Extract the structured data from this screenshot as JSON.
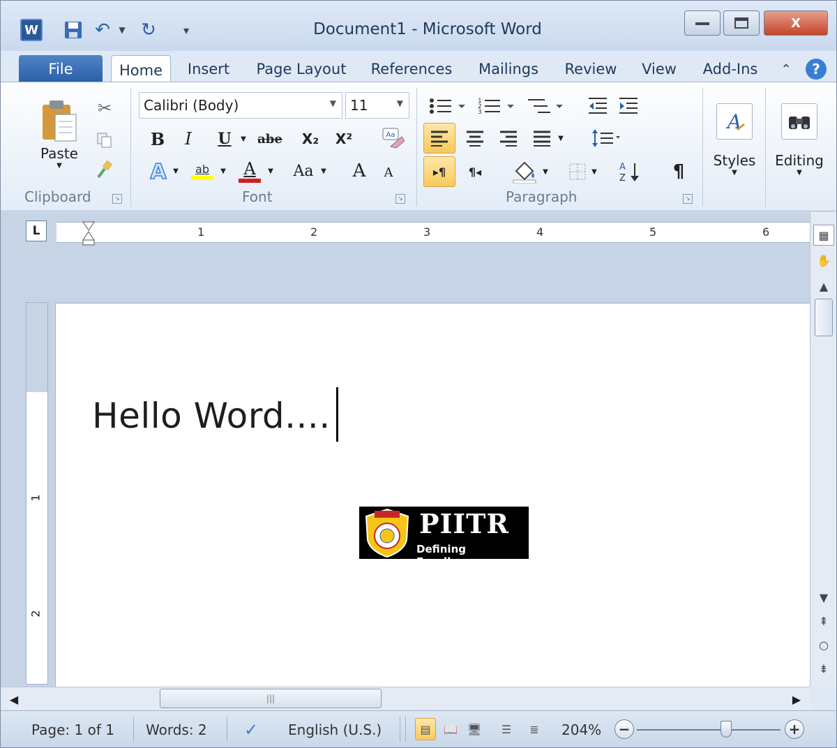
{
  "window": {
    "title": "Document1 - Microsoft Word",
    "app_icon": "W",
    "controls": {
      "minimize": "—",
      "maximize": "□",
      "close": "X"
    }
  },
  "quick_access": {
    "save_icon": "💾",
    "undo_icon": "↶",
    "redo_icon": "↻",
    "customize_icon": "⊽"
  },
  "ribbon_tabs": [
    {
      "label": "File"
    },
    {
      "label": "Home"
    },
    {
      "label": "Insert"
    },
    {
      "label": "Page Layout"
    },
    {
      "label": "References"
    },
    {
      "label": "Mailings"
    },
    {
      "label": "Review"
    },
    {
      "label": "View"
    },
    {
      "label": "Add-Ins"
    }
  ],
  "ribbon": {
    "clipboard": {
      "label": "Clipboard",
      "paste": "Paste"
    },
    "font": {
      "label": "Font",
      "font_name": "Calibri (Body)",
      "font_size": "11",
      "bold": "B",
      "italic": "I",
      "underline": "U",
      "strike": "abe",
      "subscript": "X₂",
      "superscript": "X²",
      "change_case": "Aa",
      "grow": "A",
      "shrink": "A",
      "font_color": "A",
      "highlight": "ab"
    },
    "paragraph": {
      "label": "Paragraph",
      "pilcrow": "¶"
    },
    "styles": {
      "label": "Styles"
    },
    "editing": {
      "label": "Editing"
    }
  },
  "ruler": {
    "tab_selector": "L",
    "numbers": [
      "1",
      "2",
      "3",
      "4",
      "5",
      "6"
    ]
  },
  "vertical_ruler": {
    "numbers": [
      "1",
      "2"
    ]
  },
  "document": {
    "text": "Hello Word...."
  },
  "logo": {
    "title": "PIITR",
    "tagline": "Defining Excellence",
    "colors": {
      "background": "#000000",
      "shield": "#f5c518"
    }
  },
  "statusbar": {
    "page": "Page: 1 of 1",
    "words": "Words: 2",
    "language": "English (U.S.)",
    "zoom": "204%",
    "zoom_minus": "−",
    "zoom_plus": "+"
  },
  "colors": {
    "file_tab": "#2a5fa8",
    "close_button": "#c4432b",
    "active_highlight": "#f8c95c"
  }
}
